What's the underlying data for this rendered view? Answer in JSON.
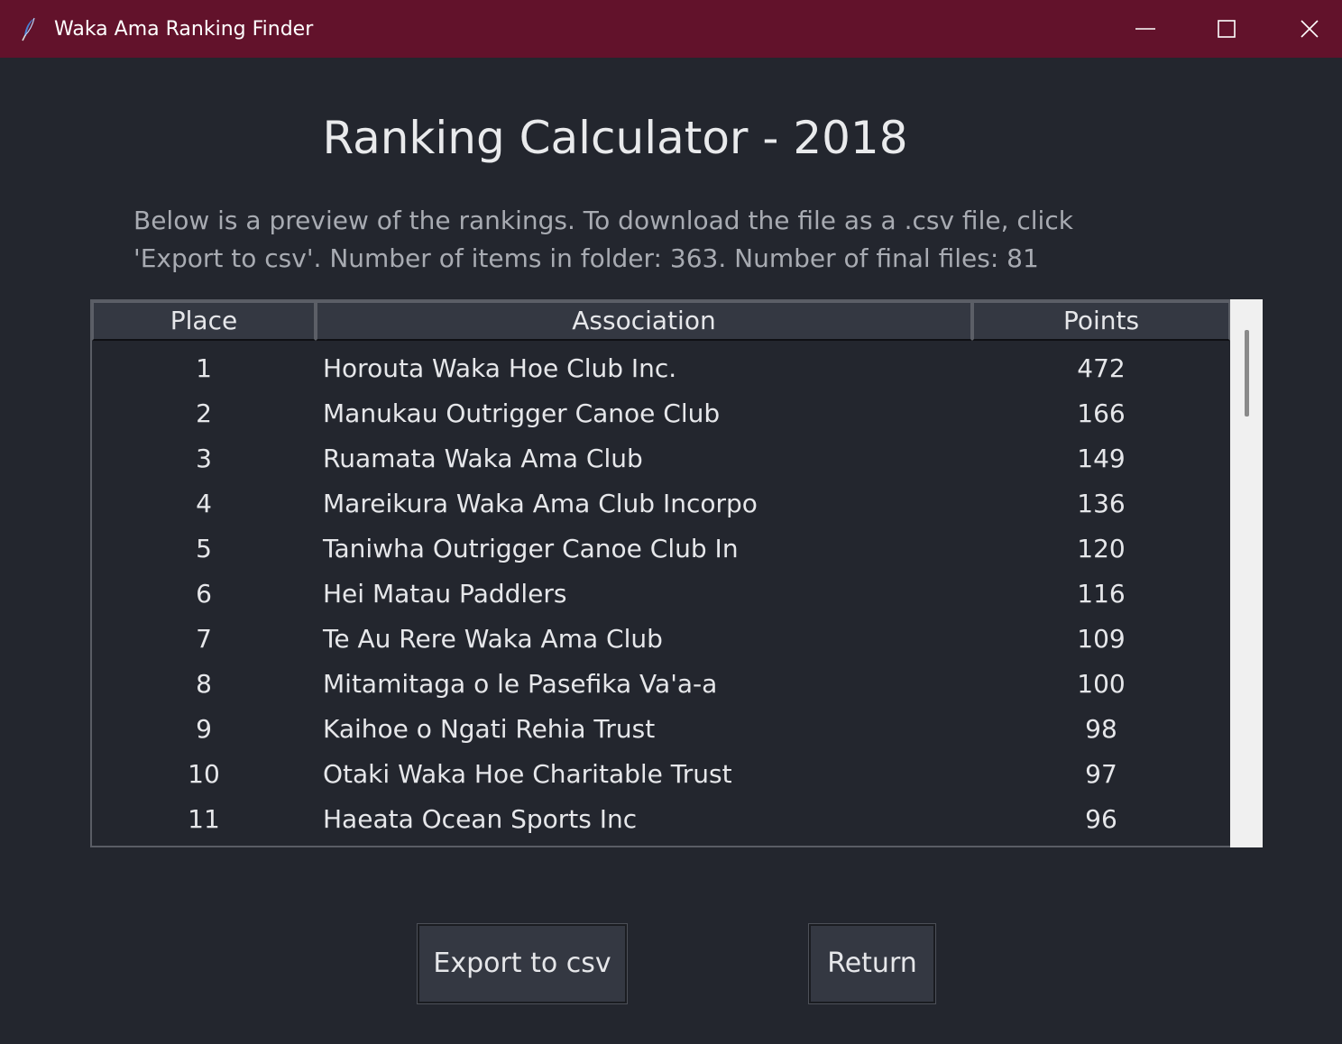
{
  "window": {
    "title": "Waka Ama Ranking Finder",
    "titlebar_color": "#62122b",
    "background_color": "#23262e"
  },
  "page": {
    "heading": "Ranking Calculator - 2018",
    "description_line1": "Below is a preview of the rankings. To download the file as a .csv file, click",
    "description_line2": "'Export to csv'. Number of items in folder: 363. Number of final files: 81"
  },
  "table": {
    "columns": [
      "Place",
      "Association",
      "Points"
    ],
    "rows": [
      {
        "place": "1",
        "association": "Horouta Waka Hoe Club Inc.",
        "points": "472"
      },
      {
        "place": "2",
        "association": "Manukau Outrigger Canoe Club",
        "points": "166"
      },
      {
        "place": "3",
        "association": "Ruamata Waka Ama Club",
        "points": "149"
      },
      {
        "place": "4",
        "association": "Mareikura Waka Ama Club Incorpo",
        "points": "136"
      },
      {
        "place": "5",
        "association": "Taniwha Outrigger Canoe Club In",
        "points": "120"
      },
      {
        "place": "6",
        "association": "Hei Matau Paddlers",
        "points": "116"
      },
      {
        "place": "7",
        "association": "Te Au Rere Waka Ama Club",
        "points": "109"
      },
      {
        "place": "8",
        "association": "Mitamitaga o le Pasefika Va'a-a",
        "points": "100"
      },
      {
        "place": "9",
        "association": "Kaihoe o Ngati Rehia Trust",
        "points": "98"
      },
      {
        "place": "10",
        "association": "Otaki Waka Hoe Charitable Trust",
        "points": "97"
      },
      {
        "place": "11",
        "association": "Haeata Ocean Sports Inc",
        "points": "96"
      }
    ]
  },
  "buttons": {
    "export_label": "Export to csv",
    "return_label": "Return"
  },
  "icons": {
    "app": "feather-icon",
    "minimize": "minimize-icon",
    "maximize": "maximize-icon",
    "close": "close-icon"
  }
}
